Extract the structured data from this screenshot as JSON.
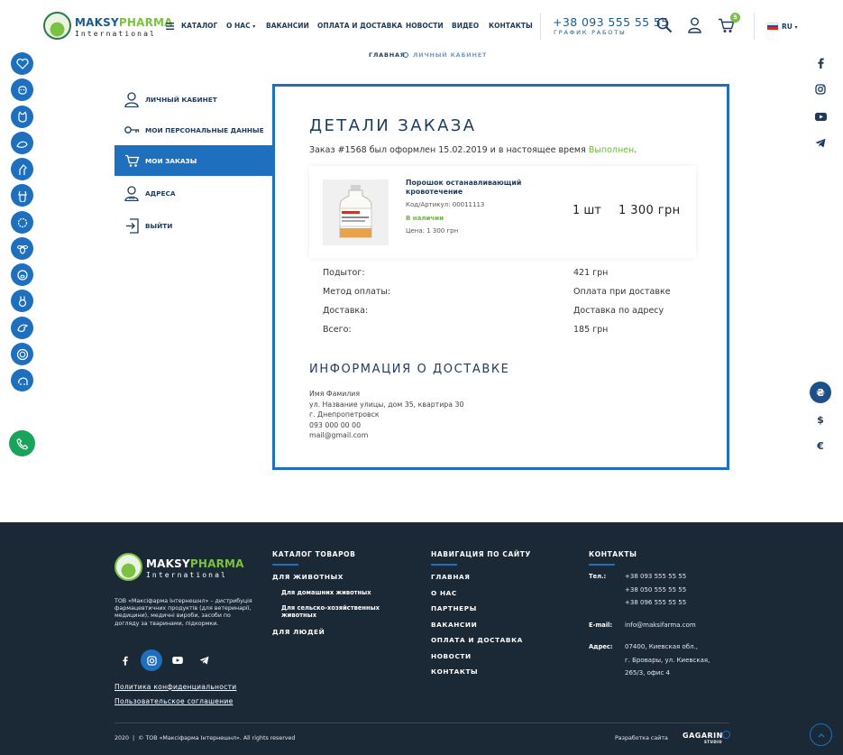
{
  "header": {
    "logo_main_a": "MAKSY",
    "logo_main_b": "PHARMA",
    "logo_sub": "International",
    "nav": [
      "Каталог",
      "О нас",
      "Вакансии",
      "Оплата и доставка",
      "Новости",
      "Видео",
      "Контакты"
    ],
    "phone": "+38 093 555 55 55",
    "work_hours": "График работы",
    "cart_count": "5",
    "lang": "RU"
  },
  "breadcrumb": {
    "home": "Главная",
    "current": "Личный кабинет"
  },
  "account_menu": [
    {
      "label": "Личный кабинет",
      "icon": "user-icon"
    },
    {
      "label": "Мои персональные данные",
      "icon": "key-icon"
    },
    {
      "label": "Мои заказы",
      "icon": "cart-icon"
    },
    {
      "label": "Адреса",
      "icon": "address-icon"
    },
    {
      "label": "Выйти",
      "icon": "logout-icon"
    }
  ],
  "order": {
    "title": "Детали заказа",
    "status_prefix": "Заказ #1568 был оформлен 15.02.2019 и в настоящее время",
    "status": "Выполнен",
    "status_suffix": ".",
    "product": {
      "name": "Порошок останавливающий кровотечение",
      "sku": "Код/Артикул: 00011113",
      "stock": "В наличии",
      "price": "Цена: 1 300 грн",
      "qty": "1 шт",
      "total": "1 300 грн"
    },
    "summary": [
      {
        "label": "Подытог:",
        "value": "421 грн"
      },
      {
        "label": "Метод оплаты:",
        "value": "Оплата при доставке"
      },
      {
        "label": "Доставка:",
        "value": "Доставка по адресу"
      },
      {
        "label": "Всего:",
        "value": "185 грн"
      }
    ],
    "delivery_title": "Информация о доставке",
    "delivery_lines": [
      "Имя Фамилия",
      "ул. Название улицы, дом 35, квартира 30",
      "г. Днепропетровск",
      "093 000 00 00",
      "mail@gmail.com"
    ]
  },
  "currencies": [
    "₴",
    "$",
    "€"
  ],
  "footer": {
    "logo_main_a": "MAKSY",
    "logo_main_b": "PHARMA",
    "logo_sub": "International",
    "about": "ТОВ «Максіфарма Інтернешнл» – дистрибуція фармацевтичних продуктів (для ветеринарії, медицини), медичні вироби, засоби по догляду за тваринами, підкормки.",
    "policy": "Политика конфиденциальности",
    "agreement": "Пользовательское соглашение",
    "catalog_title": "Каталог товаров",
    "catalog_animals": "Для животных",
    "catalog_sub": [
      "Для домашних животных",
      "Для сельско-хозяйственных животных"
    ],
    "catalog_people": "Для людей",
    "nav_title": "Навигация по сайту",
    "nav_links": [
      "Главная",
      "О нас",
      "Партнеры",
      "Вакансии",
      "Оплата и доставка",
      "Новости",
      "Контакты"
    ],
    "contacts_title": "Контакты",
    "tel_label": "Тел.:",
    "phones": [
      "+38 093 555 55 55",
      "+38 050 555 55 55",
      "+38 096 555 55 55"
    ],
    "email_label": "E-mail:",
    "email": "info@maksifarma.com",
    "address_label": "Адрес:",
    "address": [
      "07400, Киевская обл.,",
      "г. Бровары, ул. Киевская,",
      "265/3, офис 4"
    ],
    "copyright": "2020  |  © ТОВ «Максіфарма Інтернешнл». All rights reserved",
    "dev_label": "Разработка сайта",
    "dev_brand": "GAGARIN",
    "dev_brand_sub": "STUDIO"
  },
  "colors": {
    "primary": "#1e6fbd",
    "green": "#6fb73b",
    "navy": "#1e3a5c",
    "footer_bg": "#1b2836"
  }
}
